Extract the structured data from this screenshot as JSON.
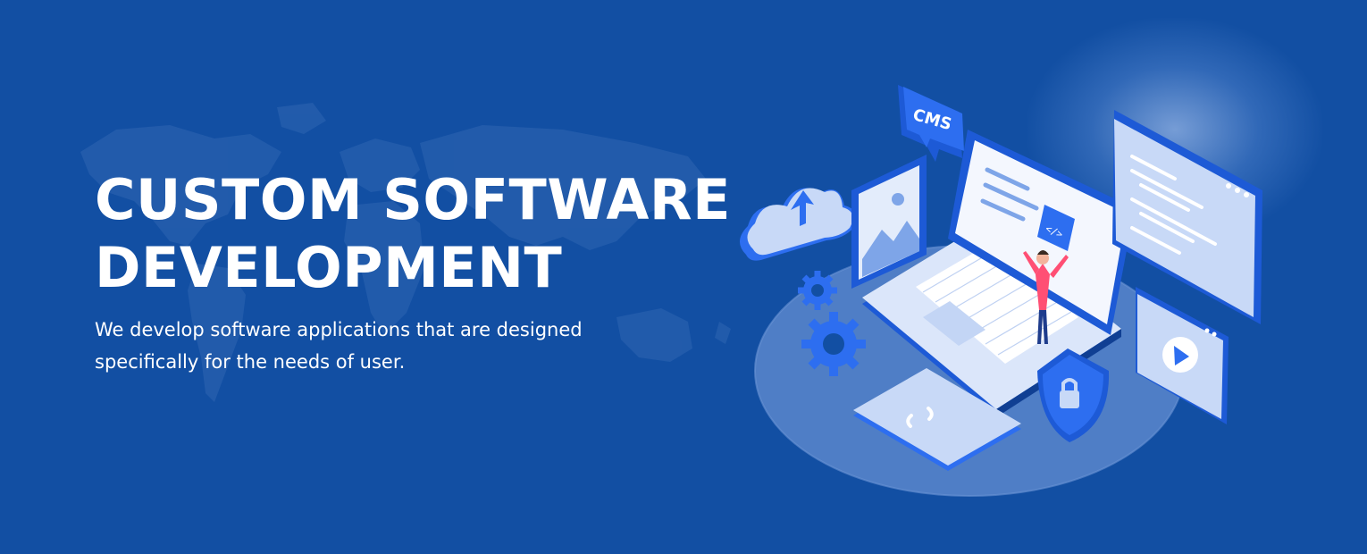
{
  "hero": {
    "title_line1": "CUSTOM SOFTWARE",
    "title_line2": "DEVELOPMENT",
    "subtitle_line1": "We develop software applications that are designed",
    "subtitle_line2": "specifically for the needs of user."
  },
  "illustration": {
    "cms_label": "CMS",
    "code_tag": "</>"
  },
  "colors": {
    "background": "#124fa3",
    "text": "#ffffff",
    "accent_blue": "#2d6ef0",
    "light_blue": "#b9cff7",
    "figure_shirt": "#ff4f74"
  },
  "icons": [
    "world-map",
    "cloud-upload-icon",
    "image-icon",
    "cms-bubble-icon",
    "laptop-icon",
    "code-icon",
    "gear-icon",
    "shield-lock-icon",
    "video-play-icon",
    "browser-window-icon",
    "code-brackets-icon"
  ]
}
